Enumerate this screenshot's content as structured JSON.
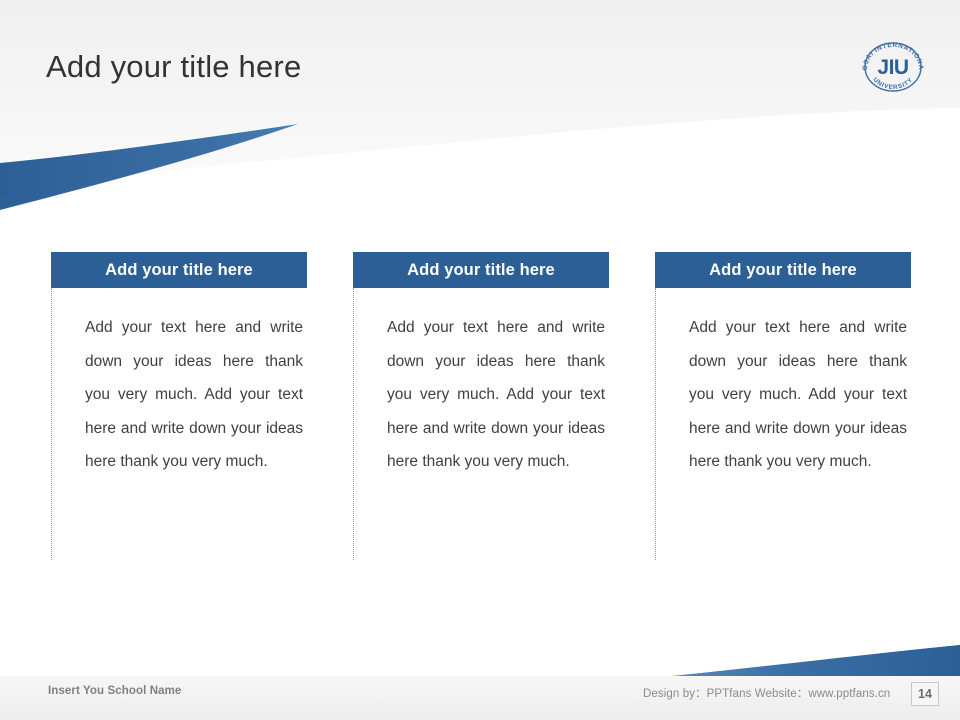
{
  "slide": {
    "title": "Add your title here",
    "accent_color": "#2c5f96",
    "title_color": "#333333",
    "background_color": "#ffffff"
  },
  "logo": {
    "name": "josai-international-university-logo",
    "center_text": "JIU",
    "arc_top_text": "JOSAI INTERNATIONAL",
    "arc_bottom_text": "UNIVERSITY",
    "color": "#3a6ea5"
  },
  "columns": [
    {
      "header": "Add your title here",
      "body": "Add your text here and write down your ideas here thank you very much. Add your text here and write down your ideas here thank you very much."
    },
    {
      "header": "Add your title here",
      "body": "Add your text here and write down your ideas here thank you very much. Add your text here and write down your ideas here thank you very much."
    },
    {
      "header": "Add your title here",
      "body": "Add your text here and write down your ideas here thank you very much. Add your text here and write down your ideas here thank you very much."
    }
  ],
  "footer": {
    "school_name": "Insert You School Name",
    "credit": "Design by：PPTfans  Website：www.pptfans.cn",
    "page_number": "14"
  }
}
